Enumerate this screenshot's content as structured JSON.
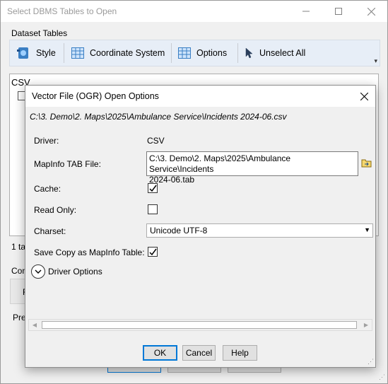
{
  "parent": {
    "title": "Select DBMS Tables to Open",
    "group_label": "Dataset Tables",
    "toolbar": {
      "style": "Style",
      "coordinate_system": "Coordinate System",
      "options": "Options",
      "unselect_all": "Unselect All"
    },
    "list_item": "CSV",
    "count_text": "1 ta",
    "con_label": "Con",
    "con_box_text": "R",
    "pre_label": "Pre"
  },
  "dialog": {
    "title": "Vector File (OGR) Open Options",
    "path": "C:\\3. Demo\\2. Maps\\2025\\Ambulance Service\\Incidents 2024-06.csv",
    "driver_label": "Driver:",
    "driver_value": "CSV",
    "tabfile_label": "MapInfo TAB File:",
    "tabfile_value": "C:\\3. Demo\\2. Maps\\2025\\Ambulance Service\\Incidents\n2024-06.tab",
    "cache_label": "Cache:",
    "cache_checked": true,
    "readonly_label": "Read Only:",
    "readonly_checked": false,
    "charset_label": "Charset:",
    "charset_value": "Unicode UTF-8",
    "savecopy_label": "Save Copy as MapInfo Table:",
    "savecopy_checked": true,
    "driver_options_label": "Driver Options",
    "ok": "OK",
    "cancel": "Cancel",
    "help": "Help"
  },
  "colors": {
    "accent": "#0078d7",
    "toolbar_bg": "#e7eef7",
    "icon_blue": "#3a7fc4"
  }
}
